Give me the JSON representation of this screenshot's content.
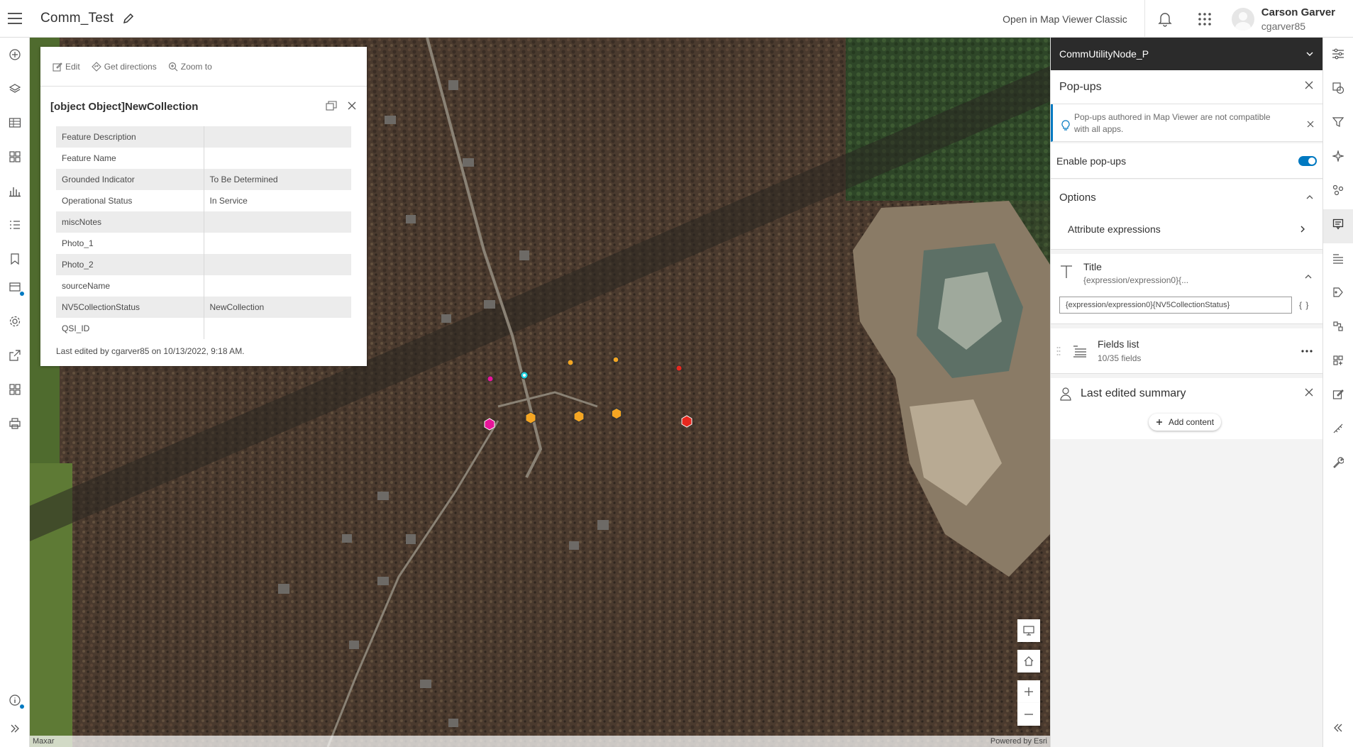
{
  "app": {
    "title": "Comm_Test",
    "open_classic": "Open in Map Viewer Classic",
    "user_name": "Carson Garver",
    "user_login": "cgarver85"
  },
  "popup": {
    "actions": [
      "Edit",
      "Get directions",
      "Zoom to"
    ],
    "title": "[object Object]NewCollection",
    "fields": [
      {
        "key": "Feature Description",
        "value": ""
      },
      {
        "key": "Feature Name",
        "value": ""
      },
      {
        "key": "Grounded Indicator",
        "value": "To Be Determined"
      },
      {
        "key": "Operational Status",
        "value": "In Service"
      },
      {
        "key": "miscNotes",
        "value": ""
      },
      {
        "key": "Photo_1",
        "value": ""
      },
      {
        "key": "Photo_2",
        "value": ""
      },
      {
        "key": "sourceName",
        "value": ""
      },
      {
        "key": "NV5CollectionStatus",
        "value": "NewCollection"
      },
      {
        "key": "QSI_ID",
        "value": ""
      }
    ],
    "last_edited": "Last edited by cgarver85 on 10/13/2022, 9:18 AM."
  },
  "map": {
    "attribution_left": "Maxar",
    "attribution_right": "Powered by Esri"
  },
  "panel": {
    "layer_name": "CommUtilityNode_P",
    "header": "Pop-ups",
    "notice": "Pop-ups authored in Map Viewer are not compatible with all apps.",
    "enable_label": "Enable pop-ups",
    "options_label": "Options",
    "attribute_expressions": "Attribute expressions",
    "title_label": "Title",
    "title_preview": "{expression/expression0}{...",
    "title_value": "{expression/expression0}{NV5CollectionStatus}",
    "braces": "{ }",
    "fields_list": "Fields list",
    "fields_count": "10/35 fields",
    "last_edited_summary": "Last edited summary",
    "add_content": "Add content"
  },
  "colors": {
    "accent": "#0079c1",
    "header_dark": "#2b2b2b",
    "marker_orange": "#f5a623",
    "marker_red": "#e8281e",
    "marker_magenta": "#e8169a",
    "marker_cyan": "#1fd3e0"
  }
}
